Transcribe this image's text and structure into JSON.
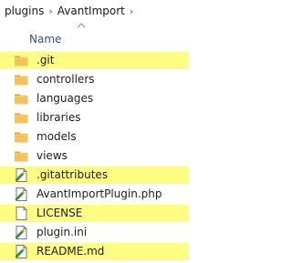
{
  "breadcrumb": {
    "items": [
      "plugins",
      "AvantImport"
    ],
    "separator": "›"
  },
  "columns": {
    "name_header": "Name",
    "sort_icon": "chevron-up-icon"
  },
  "colors": {
    "highlight": "#fdfd82",
    "folder": "#f5c25a",
    "header_text": "#3b4f72"
  },
  "files": [
    {
      "name": ".git",
      "type": "folder",
      "highlighted": true
    },
    {
      "name": "controllers",
      "type": "folder",
      "highlighted": false
    },
    {
      "name": "languages",
      "type": "folder",
      "highlighted": false
    },
    {
      "name": "libraries",
      "type": "folder",
      "highlighted": false
    },
    {
      "name": "models",
      "type": "folder",
      "highlighted": false
    },
    {
      "name": "views",
      "type": "folder",
      "highlighted": false
    },
    {
      "name": ".gitattributes",
      "type": "file-edit",
      "highlighted": true
    },
    {
      "name": "AvantImportPlugin.php",
      "type": "file-edit",
      "highlighted": false
    },
    {
      "name": "LICENSE",
      "type": "file-blank",
      "highlighted": true
    },
    {
      "name": "plugin.ini",
      "type": "file-edit",
      "highlighted": false
    },
    {
      "name": "README.md",
      "type": "file-edit",
      "highlighted": true
    }
  ]
}
